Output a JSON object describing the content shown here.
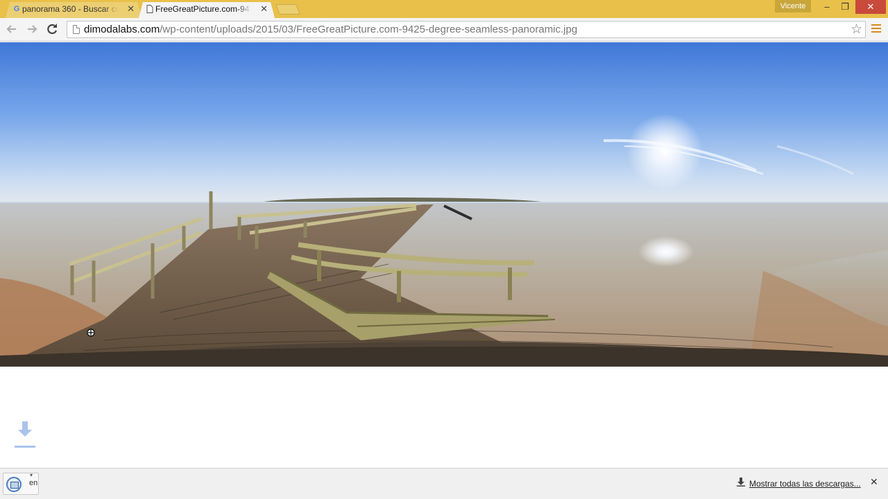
{
  "tabs": [
    {
      "title": "panorama 360 - Buscar co",
      "favicon": "google-g-icon",
      "active": false
    },
    {
      "title": "FreeGreatPicture.com-942",
      "favicon": "page-icon",
      "active": true
    }
  ],
  "profile": {
    "name": "Vicente"
  },
  "window_controls": {
    "minimize": "–",
    "maximize": "❐",
    "close": "✕"
  },
  "omnibox": {
    "host": "dimodalabs.com",
    "path": "/wp-content/uploads/2015/03/FreeGreatPicture.com-9425-degree-seamless-panoramic.jpg"
  },
  "nav": {
    "back": "🡐",
    "forward": "🡒",
    "reload": "↻",
    "bookmark": "☆"
  },
  "downloads_shelf": {
    "item_name": "en",
    "show_all_label": "Mostrar todas las descargas...",
    "close": "✕"
  },
  "colors": {
    "titlebar": "#e8c04a",
    "accent": "#4a7fc0",
    "close_button": "#c94a3a"
  }
}
